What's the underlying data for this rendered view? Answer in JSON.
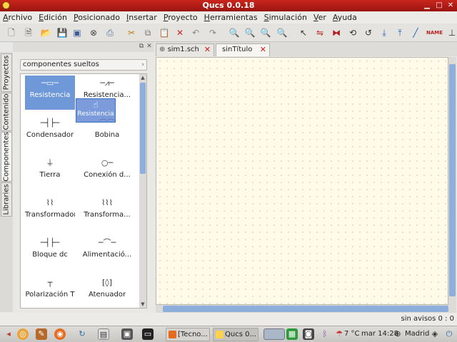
{
  "window": {
    "title": "Qucs 0.0.18"
  },
  "menu": [
    "Archivo",
    "Edición",
    "Posicionado",
    "Insertar",
    "Proyecto",
    "Herramientas",
    "Simulación",
    "Ver",
    "Ayuda"
  ],
  "dock": {
    "tabs": [
      "Proyectos",
      "Contenido",
      "Componentes",
      "Libraries"
    ],
    "category": "componentes sueltos",
    "components": [
      {
        "label": "Resistencia",
        "icon": "resistor-icon",
        "glyph": "─▭─"
      },
      {
        "label": "Resistencia...",
        "icon": "resistor-us-icon",
        "glyph": "─⩘─"
      },
      {
        "label": "Condensador",
        "icon": "capacitor-icon",
        "glyph": "─┤├─"
      },
      {
        "label": "Bobina",
        "icon": "inductor-icon",
        "glyph": "⌒⌒"
      },
      {
        "label": "Tierra",
        "icon": "ground-icon",
        "glyph": "⏚"
      },
      {
        "label": "Conexión d...",
        "icon": "port-icon",
        "glyph": "○─"
      },
      {
        "label": "Transformador",
        "icon": "transformer-icon",
        "glyph": "⌇⌇"
      },
      {
        "label": "Transforma...",
        "icon": "symmetric-transformer-icon",
        "glyph": "⌇⌇⌇"
      },
      {
        "label": "Bloque dc",
        "icon": "dc-block-icon",
        "glyph": "─┤├─"
      },
      {
        "label": "Alimentació...",
        "icon": "dc-feed-icon",
        "glyph": "─⌒─"
      },
      {
        "label": "Polarización T",
        "icon": "bias-t-icon",
        "glyph": "┬"
      },
      {
        "label": "Atenuador",
        "icon": "attenuator-icon",
        "glyph": "[◊]"
      }
    ],
    "drag_ghost": {
      "label": "Resistencia"
    }
  },
  "tabs": [
    {
      "label": "sim1.sch"
    },
    {
      "label": "sinTítulo"
    }
  ],
  "status": {
    "message": "sin avisos 0 : 0"
  },
  "taskbar": {
    "tasks": [
      {
        "label": "[Tecno..."
      },
      {
        "label": "Qucs 0..."
      }
    ],
    "weather": "7 °C",
    "clock": "mar 14:28",
    "location": "Madrid"
  }
}
